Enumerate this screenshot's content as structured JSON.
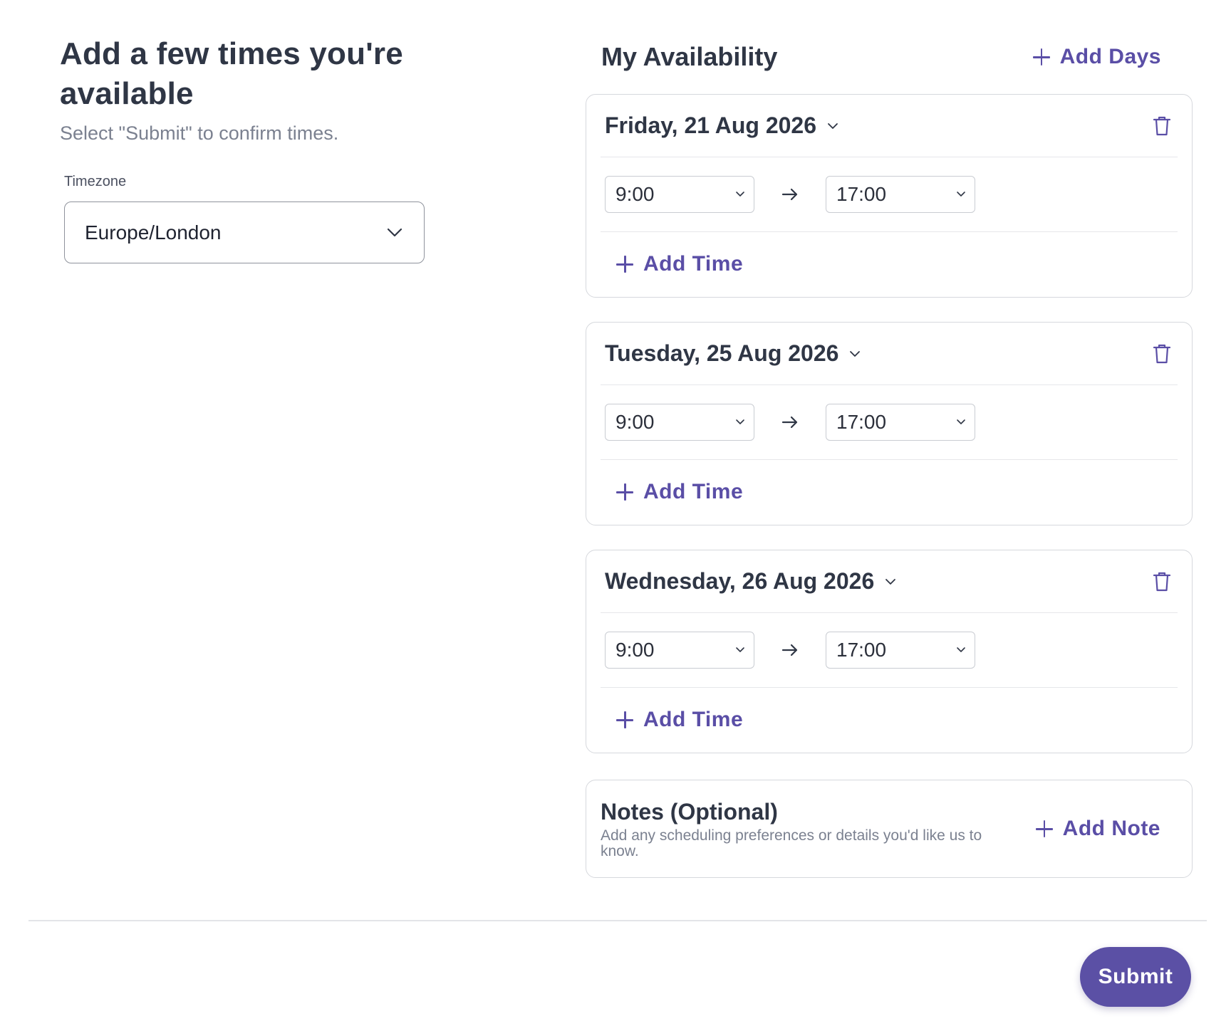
{
  "header": {
    "title": "Add a few times you're available",
    "subtitle": "Select \"Submit\" to confirm times."
  },
  "timezone": {
    "label": "Timezone",
    "value": "Europe/London"
  },
  "availability": {
    "title": "My Availability",
    "add_days_label": "Add Days",
    "add_time_label": "Add Time",
    "days": [
      {
        "date": "Friday, 21 Aug 2026",
        "start": "9:00",
        "end": "17:00"
      },
      {
        "date": "Tuesday, 25 Aug 2026",
        "start": "9:00",
        "end": "17:00"
      },
      {
        "date": "Wednesday, 26 Aug 2026",
        "start": "9:00",
        "end": "17:00"
      }
    ]
  },
  "notes": {
    "title": "Notes (Optional)",
    "description": "Add any scheduling preferences or details you'd like us to know.",
    "add_note_label": "Add Note"
  },
  "footer": {
    "submit_label": "Submit"
  },
  "colors": {
    "accent": "#5b50a5",
    "text": "#2f3645",
    "muted": "#7b8190"
  }
}
